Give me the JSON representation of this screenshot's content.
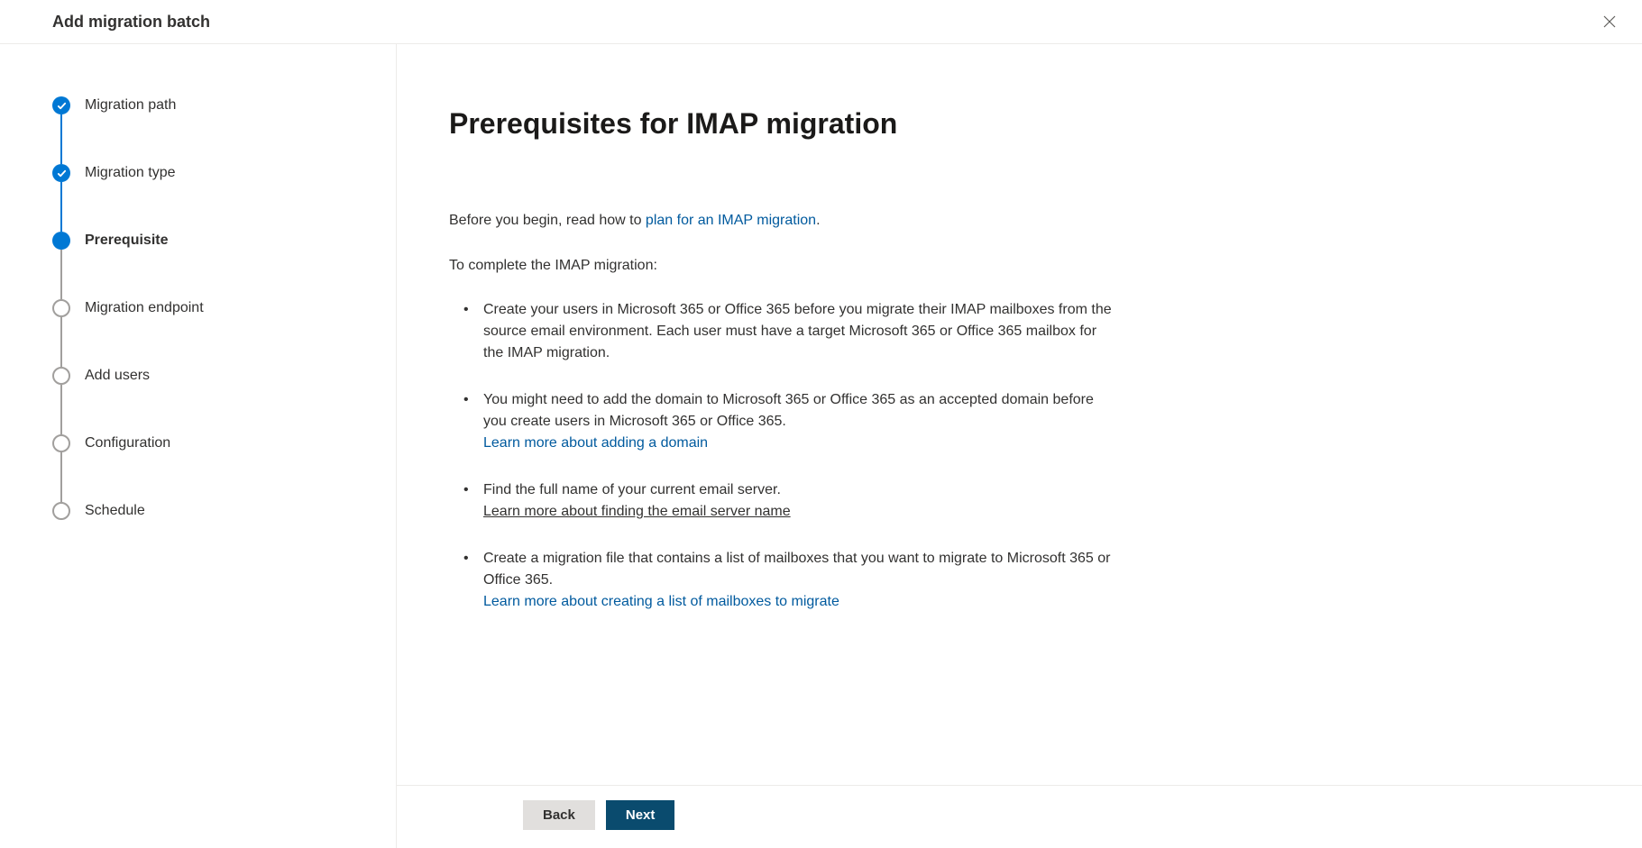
{
  "header": {
    "title": "Add migration batch"
  },
  "steps": [
    {
      "label": "Migration path",
      "state": "completed"
    },
    {
      "label": "Migration type",
      "state": "completed"
    },
    {
      "label": "Prerequisite",
      "state": "current"
    },
    {
      "label": "Migration endpoint",
      "state": "pending"
    },
    {
      "label": "Add users",
      "state": "pending"
    },
    {
      "label": "Configuration",
      "state": "pending"
    },
    {
      "label": "Schedule",
      "state": "pending"
    }
  ],
  "content": {
    "title": "Prerequisites for IMAP migration",
    "intro_prefix": "Before you begin, read how to ",
    "intro_link": "plan for an IMAP migration",
    "intro_suffix": ".",
    "section_label": "To complete the IMAP migration:",
    "bullets": [
      {
        "text": "Create your users in Microsoft 365 or Office 365 before you migrate their IMAP mailboxes from the source email environment. Each user must have a target Microsoft 365 or Office 365 mailbox for the IMAP migration."
      },
      {
        "text": "You might need to add the domain to Microsoft 365 or Office 365 as an accepted domain before you create users in Microsoft 365 or Office 365.",
        "link": "Learn more about adding a domain",
        "link_style": "normal"
      },
      {
        "text": "Find the full name of your current email server.",
        "link": "Learn more about finding the email server name",
        "link_style": "underlined"
      },
      {
        "text": "Create a migration file that contains a list of mailboxes that you want to migrate to Microsoft 365 or Office 365.",
        "link": "Learn more about creating a list of mailboxes to migrate",
        "link_style": "normal"
      }
    ]
  },
  "footer": {
    "back_label": "Back",
    "next_label": "Next"
  }
}
